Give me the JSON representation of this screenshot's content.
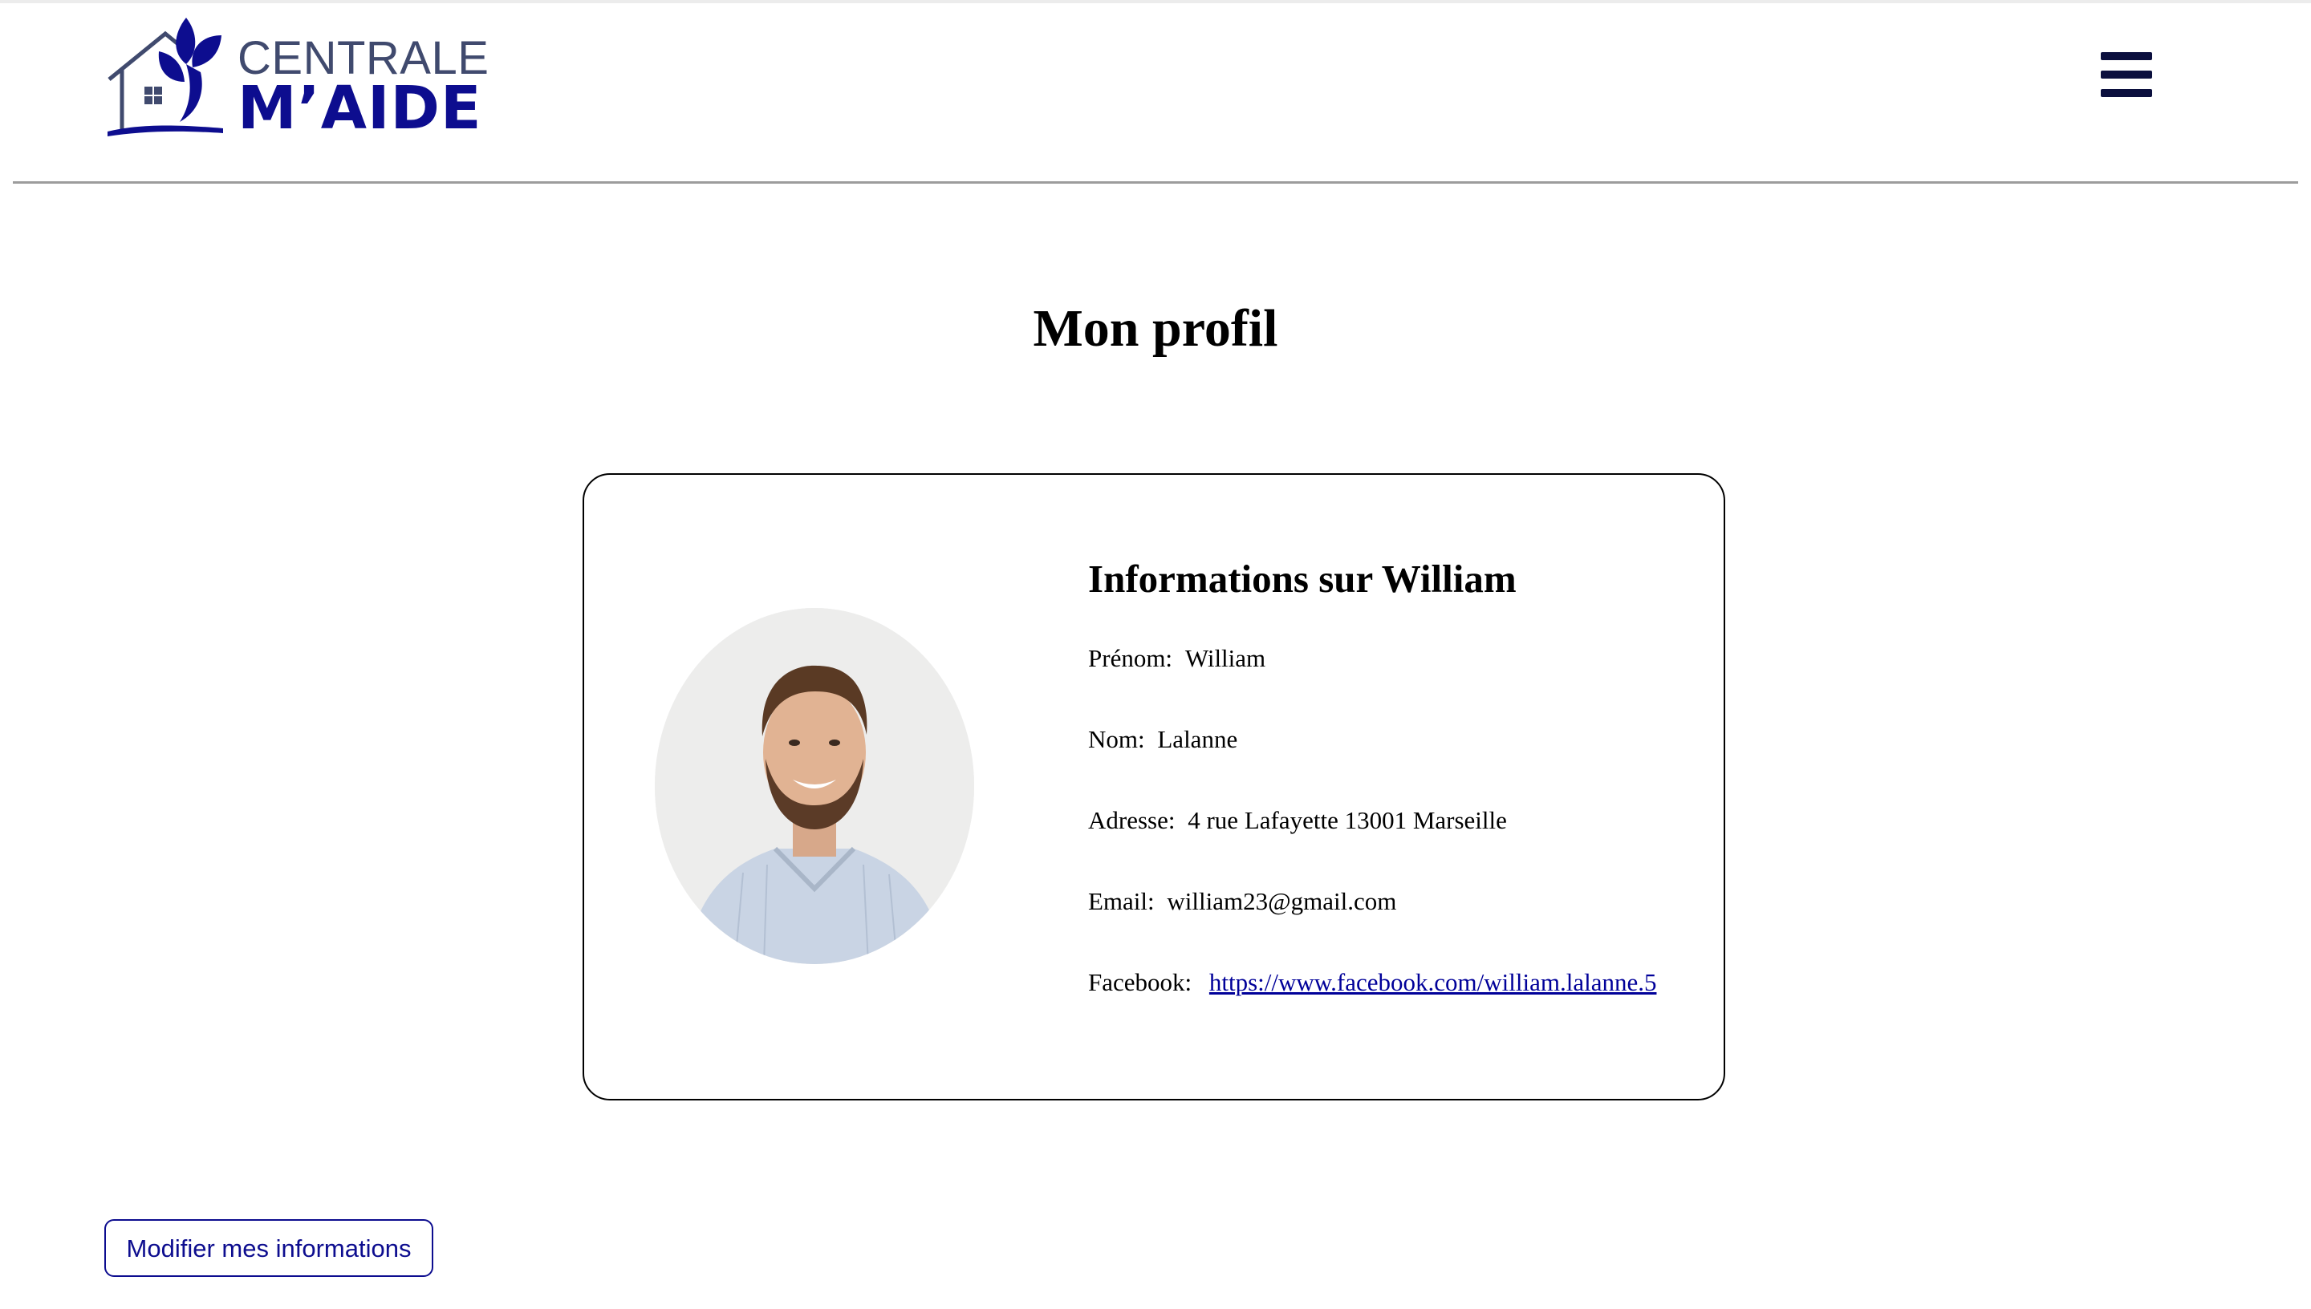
{
  "header": {
    "logo": {
      "line1": "CENTRALE",
      "line2": "M’AIDE"
    },
    "menu_icon": "hamburger-menu-icon"
  },
  "page": {
    "title": "Mon profil"
  },
  "profile": {
    "heading": "Informations sur William",
    "fields": {
      "first_name_label": "Prénom:",
      "first_name": "William",
      "last_name_label": "Nom:",
      "last_name": "Lalanne",
      "address_label": "Adresse:",
      "address": "4 rue Lafayette 13001 Marseille",
      "email_label": "Email:",
      "email": "william23@gmail.com",
      "facebook_label": "Facebook:",
      "facebook_url": "https://www.facebook.com/william.lalanne.5"
    },
    "avatar_icon": "profile-photo"
  },
  "actions": {
    "edit_label": "Modifier mes informations"
  },
  "colors": {
    "brand_blue": "#0d0d8f",
    "logo_gray": "#404a6e",
    "menu_icon": "#0b0f3e",
    "link": "#000099",
    "divider": "#9c9c9c"
  }
}
